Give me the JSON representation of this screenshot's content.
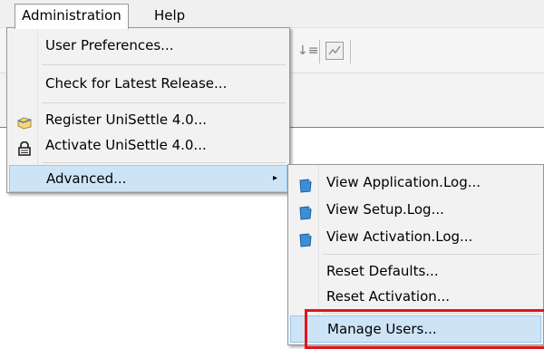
{
  "menubar": {
    "items": [
      {
        "label": "Administration"
      },
      {
        "label": "Help"
      }
    ]
  },
  "admin_menu": {
    "items": [
      {
        "label": "User Preferences..."
      },
      {
        "label": "Check for Latest Release..."
      },
      {
        "label": "Register UniSettle 4.0...",
        "icon": "register-icon"
      },
      {
        "label": "Activate UniSettle 4.0...",
        "icon": "lock-icon"
      },
      {
        "label": "Advanced...",
        "submenu_arrow": "▸"
      }
    ]
  },
  "advanced_menu": {
    "items": [
      {
        "label": "View Application.Log...",
        "icon": "log-icon"
      },
      {
        "label": "View Setup.Log...",
        "icon": "log-icon"
      },
      {
        "label": "View Activation.Log...",
        "icon": "log-icon"
      },
      {
        "label": "Reset Defaults..."
      },
      {
        "label": "Reset Activation..."
      },
      {
        "label": "Manage Users..."
      }
    ]
  },
  "colors": {
    "highlight": "#cde4f7",
    "highlight_border": "#99c9ef",
    "annotation": "#e3151b"
  }
}
